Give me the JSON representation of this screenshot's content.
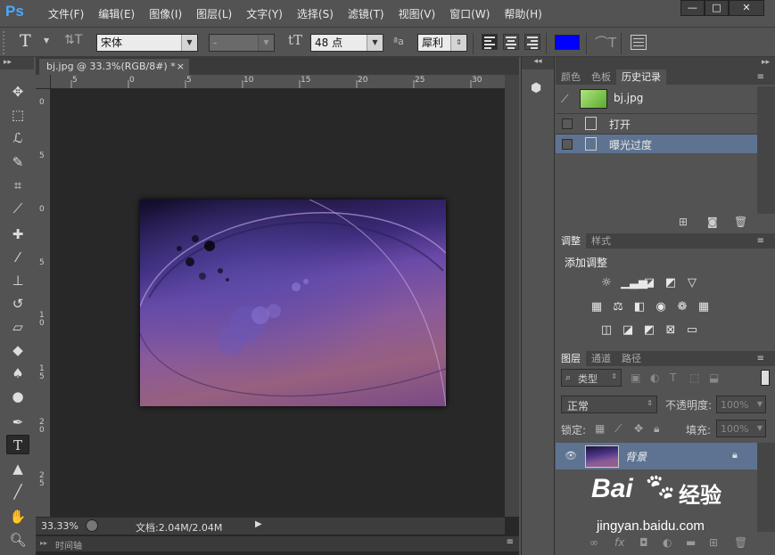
{
  "app": {
    "logo": "Ps"
  },
  "menu": [
    "文件(F)",
    "编辑(E)",
    "图像(I)",
    "图层(L)",
    "文字(Y)",
    "选择(S)",
    "滤镜(T)",
    "视图(V)",
    "窗口(W)",
    "帮助(H)"
  ],
  "window_buttons": {
    "minimize": "—",
    "restore": "□",
    "close": "✕"
  },
  "options": {
    "font_family": "宋体",
    "font_style": "-",
    "font_size": "48 点",
    "anti_alias": "犀利",
    "text_color": "#0000ff"
  },
  "document": {
    "tab_title": "bj.jpg @ 33.3%(RGB/8#) *",
    "close": "×",
    "zoom": "33.33%",
    "doc_info": "文档:2.04M/2.04M",
    "timeline_label": "时间轴"
  },
  "ruler_h": [
    "5",
    "0",
    "5",
    "10",
    "15",
    "20",
    "25",
    "30"
  ],
  "ruler_v": [
    "0",
    "5",
    "0",
    "5",
    "1\n0",
    "1\n5",
    "2\n0",
    "2\n5"
  ],
  "history_panel": {
    "tabs": [
      "颜色",
      "色板",
      "历史记录"
    ],
    "active_tab": "历史记录",
    "snapshot": "bj.jpg",
    "items": [
      {
        "label": "打开",
        "selected": false
      },
      {
        "label": "曝光过度",
        "selected": true
      }
    ]
  },
  "adjustments_panel": {
    "tabs": [
      "调整",
      "样式"
    ],
    "title": "添加调整"
  },
  "layers_panel": {
    "tabs": [
      "图层",
      "通道",
      "路径"
    ],
    "filter_kind": "类型",
    "blend_mode": "正常",
    "opacity_label": "不透明度:",
    "opacity_value": "100%",
    "lock_label": "锁定:",
    "fill_label": "填充:",
    "fill_value": "100%",
    "layers": [
      {
        "name": "背景",
        "locked": true,
        "visible": true
      }
    ]
  },
  "watermark": {
    "brand": "Bai",
    "brand_cn": "经验",
    "url": "jingyan.baidu.com"
  }
}
